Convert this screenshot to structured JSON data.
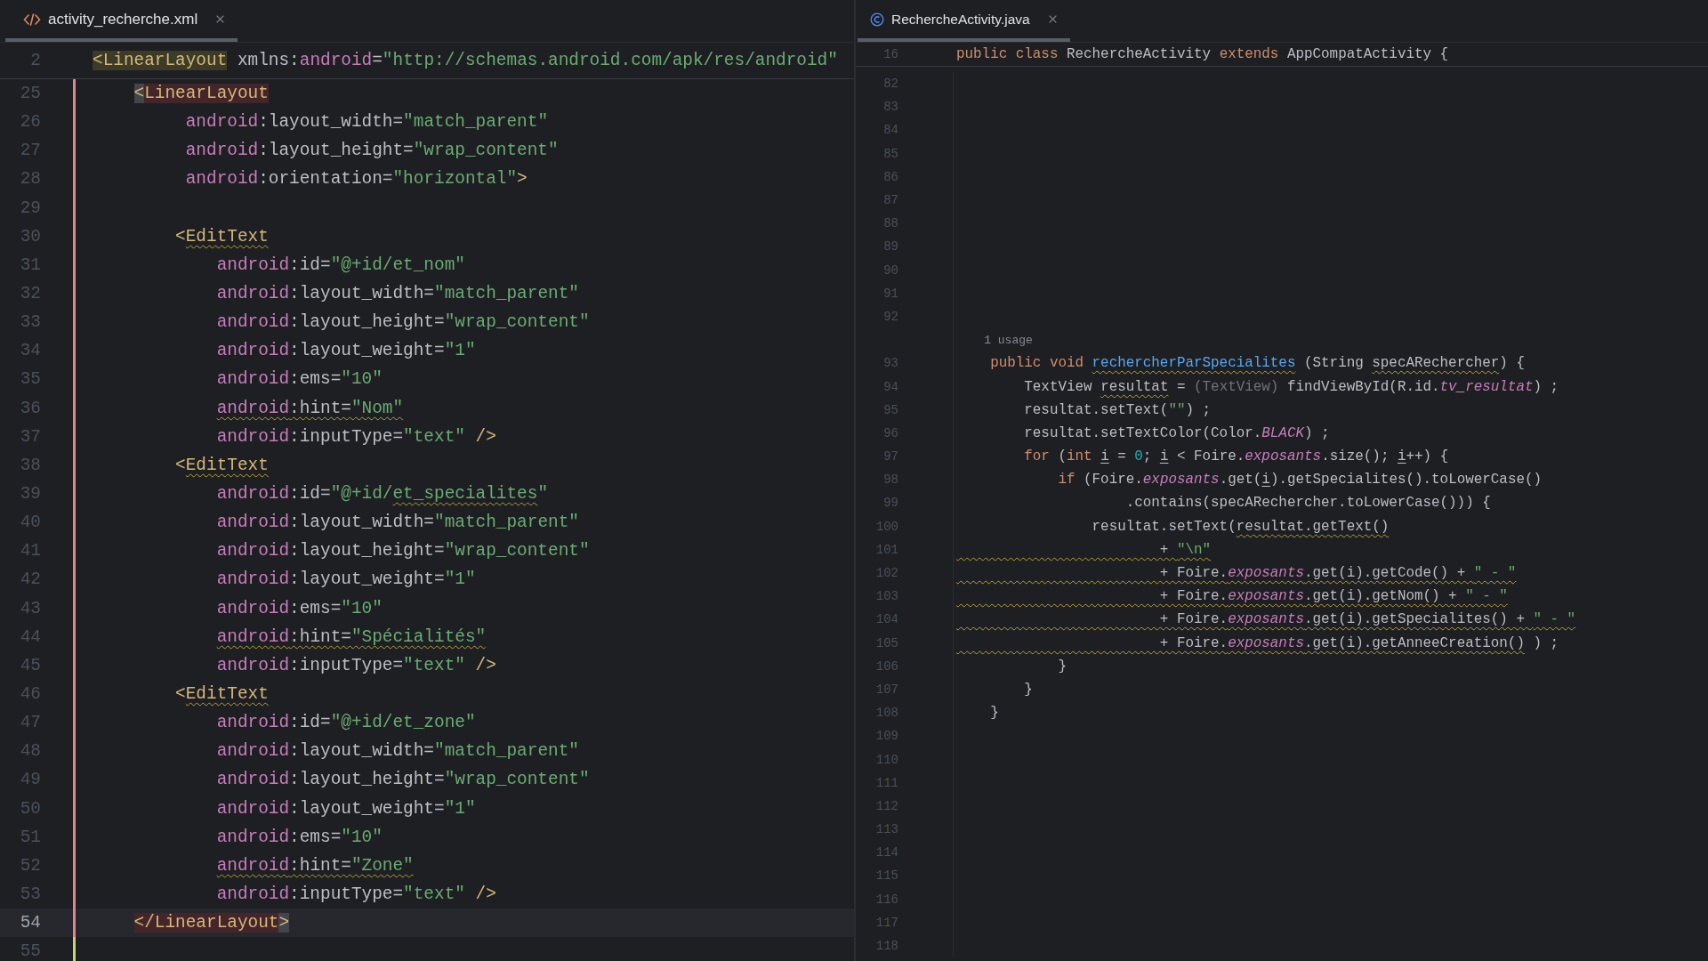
{
  "panes": [
    {
      "tab": {
        "label": "activity_recherche.xml",
        "selected": true
      },
      "sticky": {
        "n": "2",
        "tokens": [
          {
            "t": "<LinearLayout",
            "kind": "tag-match"
          },
          {
            "t": " xmlns:",
            "kind": "plain"
          },
          {
            "t": "android",
            "kind": "attr"
          },
          {
            "t": "=",
            "kind": "plain"
          },
          {
            "t": "\"http://schemas.android.com/apk/res/android\"",
            "kind": "str"
          }
        ]
      },
      "lines": [
        {
          "n": "25",
          "current": false,
          "kind": "modified",
          "tokens": [
            {
              "t": "    <",
              "kind": "tag-caret"
            },
            {
              "t": "LinearLayout",
              "kind": "tag-mismatch"
            }
          ]
        },
        {
          "n": "26",
          "current": false,
          "kind": "modified",
          "tokens": [
            {
              "t": "         android",
              "kind": "attr"
            },
            {
              "t": ":layout_width=",
              "kind": "plain"
            },
            {
              "t": "\"match_parent\"",
              "kind": "str"
            }
          ]
        },
        {
          "n": "27",
          "current": false,
          "kind": "modified",
          "tokens": [
            {
              "t": "         android",
              "kind": "attr"
            },
            {
              "t": ":layout_height=",
              "kind": "plain"
            },
            {
              "t": "\"wrap_content\"",
              "kind": "str"
            }
          ]
        },
        {
          "n": "28",
          "current": false,
          "kind": "modified",
          "tokens": [
            {
              "t": "         android",
              "kind": "attr"
            },
            {
              "t": ":orientation=",
              "kind": "plain"
            },
            {
              "t": "\"horizontal\"",
              "kind": "str"
            },
            {
              "t": ">",
              "kind": "tag"
            }
          ]
        },
        {
          "n": "29",
          "current": false,
          "kind": "modified"
        },
        {
          "n": "30",
          "current": false,
          "kind": "modified",
          "tokens": [
            {
              "t": "        <",
              "kind": "tag"
            },
            {
              "t": "EditText",
              "kind": "tag-wavy"
            }
          ]
        },
        {
          "n": "31",
          "current": false,
          "kind": "modified",
          "tokens": [
            {
              "t": "            android",
              "kind": "attr"
            },
            {
              "t": ":id=",
              "kind": "plain"
            },
            {
              "t": "\"@+id/et_nom\"",
              "kind": "str"
            }
          ]
        },
        {
          "n": "32",
          "current": false,
          "kind": "modified",
          "tokens": [
            {
              "t": "            android",
              "kind": "attr"
            },
            {
              "t": ":layout_width=",
              "kind": "plain"
            },
            {
              "t": "\"match_parent\"",
              "kind": "str"
            }
          ]
        },
        {
          "n": "33",
          "current": false,
          "kind": "modified",
          "tokens": [
            {
              "t": "            android",
              "kind": "attr"
            },
            {
              "t": ":layout_height=",
              "kind": "plain"
            },
            {
              "t": "\"wrap_content\"",
              "kind": "str"
            }
          ]
        },
        {
          "n": "34",
          "current": false,
          "kind": "modified",
          "tokens": [
            {
              "t": "            android",
              "kind": "attr"
            },
            {
              "t": ":layout_weight=",
              "kind": "plain"
            },
            {
              "t": "\"1\"",
              "kind": "str"
            }
          ]
        },
        {
          "n": "35",
          "current": false,
          "kind": "modified",
          "tokens": [
            {
              "t": "            android",
              "kind": "attr"
            },
            {
              "t": ":ems=",
              "kind": "plain"
            },
            {
              "t": "\"10\"",
              "kind": "str"
            }
          ]
        },
        {
          "n": "36",
          "current": false,
          "kind": "modified",
          "tokens": [
            {
              "t": "            android",
              "kind": "attr-wavy"
            },
            {
              "t": ":hint=",
              "kind": "plain-wavy"
            },
            {
              "t": "\"Nom\"",
              "kind": "str-wavy"
            }
          ]
        },
        {
          "n": "37",
          "current": false,
          "kind": "modified",
          "tokens": [
            {
              "t": "            android",
              "kind": "attr"
            },
            {
              "t": ":inputType=",
              "kind": "plain"
            },
            {
              "t": "\"text\"",
              "kind": "str"
            },
            {
              "t": " />",
              "kind": "tag"
            }
          ]
        },
        {
          "n": "38",
          "current": false,
          "kind": "modified",
          "tokens": [
            {
              "t": "        <",
              "kind": "tag"
            },
            {
              "t": "EditText",
              "kind": "tag-wavy"
            }
          ]
        },
        {
          "n": "39",
          "current": false,
          "kind": "modified",
          "tokens": [
            {
              "t": "            android",
              "kind": "attr"
            },
            {
              "t": ":id=",
              "kind": "plain"
            },
            {
              "t": "\"@+id/",
              "kind": "str"
            },
            {
              "t": "et_specialites",
              "kind": "str-wavy"
            },
            {
              "t": "\"",
              "kind": "str"
            }
          ]
        },
        {
          "n": "40",
          "current": false,
          "kind": "modified",
          "tokens": [
            {
              "t": "            android",
              "kind": "attr"
            },
            {
              "t": ":layout_width=",
              "kind": "plain"
            },
            {
              "t": "\"match_parent\"",
              "kind": "str"
            }
          ]
        },
        {
          "n": "41",
          "current": false,
          "kind": "modified",
          "tokens": [
            {
              "t": "            android",
              "kind": "attr"
            },
            {
              "t": ":layout_height=",
              "kind": "plain"
            },
            {
              "t": "\"wrap_content\"",
              "kind": "str"
            }
          ]
        },
        {
          "n": "42",
          "current": false,
          "kind": "modified",
          "tokens": [
            {
              "t": "            android",
              "kind": "attr"
            },
            {
              "t": ":layout_weight=",
              "kind": "plain"
            },
            {
              "t": "\"1\"",
              "kind": "str"
            }
          ]
        },
        {
          "n": "43",
          "current": false,
          "kind": "modified",
          "tokens": [
            {
              "t": "            android",
              "kind": "attr"
            },
            {
              "t": ":ems=",
              "kind": "plain"
            },
            {
              "t": "\"10\"",
              "kind": "str"
            }
          ]
        },
        {
          "n": "44",
          "current": false,
          "kind": "modified",
          "tokens": [
            {
              "t": "            android",
              "kind": "attr-wavy"
            },
            {
              "t": ":hint=",
              "kind": "plain-wavy"
            },
            {
              "t": "\"Spécialités\"",
              "kind": "str-wavy"
            }
          ]
        },
        {
          "n": "45",
          "current": false,
          "kind": "modified",
          "tokens": [
            {
              "t": "            android",
              "kind": "attr"
            },
            {
              "t": ":inputType=",
              "kind": "plain"
            },
            {
              "t": "\"text\"",
              "kind": "str"
            },
            {
              "t": " />",
              "kind": "tag"
            }
          ]
        },
        {
          "n": "46",
          "current": false,
          "kind": "modified",
          "tokens": [
            {
              "t": "        <",
              "kind": "tag"
            },
            {
              "t": "EditText",
              "kind": "tag-wavy"
            }
          ]
        },
        {
          "n": "47",
          "current": false,
          "kind": "modified",
          "tokens": [
            {
              "t": "            android",
              "kind": "attr"
            },
            {
              "t": ":id=",
              "kind": "plain"
            },
            {
              "t": "\"@+id/et_zone\"",
              "kind": "str"
            }
          ]
        },
        {
          "n": "48",
          "current": false,
          "kind": "modified",
          "tokens": [
            {
              "t": "            android",
              "kind": "attr"
            },
            {
              "t": ":layout_width=",
              "kind": "plain"
            },
            {
              "t": "\"match_parent\"",
              "kind": "str"
            }
          ]
        },
        {
          "n": "49",
          "current": false,
          "kind": "modified",
          "tokens": [
            {
              "t": "            android",
              "kind": "attr"
            },
            {
              "t": ":layout_height=",
              "kind": "plain"
            },
            {
              "t": "\"wrap_content\"",
              "kind": "str"
            }
          ]
        },
        {
          "n": "50",
          "current": false,
          "kind": "modified",
          "tokens": [
            {
              "t": "            android",
              "kind": "attr"
            },
            {
              "t": ":layout_weight=",
              "kind": "plain"
            },
            {
              "t": "\"1\"",
              "kind": "str"
            }
          ]
        },
        {
          "n": "51",
          "current": false,
          "kind": "modified",
          "tokens": [
            {
              "t": "            android",
              "kind": "attr"
            },
            {
              "t": ":ems=",
              "kind": "plain"
            },
            {
              "t": "\"10\"",
              "kind": "str"
            }
          ]
        },
        {
          "n": "52",
          "current": false,
          "kind": "modified",
          "tokens": [
            {
              "t": "            android",
              "kind": "attr-wavy"
            },
            {
              "t": ":hint=",
              "kind": "plain-wavy"
            },
            {
              "t": "\"Zone\"",
              "kind": "str-wavy"
            }
          ]
        },
        {
          "n": "53",
          "current": false,
          "kind": "modified",
          "tokens": [
            {
              "t": "            android",
              "kind": "attr"
            },
            {
              "t": ":inputType=",
              "kind": "plain"
            },
            {
              "t": "\"text\"",
              "kind": "str"
            },
            {
              "t": " />",
              "kind": "tag"
            }
          ]
        },
        {
          "n": "54",
          "current": true,
          "kind": "modified",
          "tokens": [
            {
              "t": "    </LinearLayout",
              "kind": "tag-mismatch"
            },
            {
              "t": ">",
              "kind": "tag-caret"
            }
          ]
        },
        {
          "n": "55",
          "current": false,
          "kind": "added"
        }
      ]
    },
    {
      "tab": {
        "label": "RechercheActivity.java",
        "selected": true
      },
      "sticky": {
        "n": "16",
        "tokens": [
          {
            "t": "public",
            "kind": "kw"
          },
          {
            "t": " class",
            "kind": "kw"
          },
          {
            "t": " RechercheActivity ",
            "kind": "plain"
          },
          {
            "t": "extends",
            "kind": "kw"
          },
          {
            "t": " AppCompatActivity {",
            "kind": "plain"
          }
        ]
      },
      "lines": [
        {
          "n": "82"
        },
        {
          "n": "83"
        },
        {
          "n": "84"
        },
        {
          "n": "85"
        },
        {
          "n": "86"
        },
        {
          "n": "87"
        },
        {
          "n": "88"
        },
        {
          "n": "89"
        },
        {
          "n": "90"
        },
        {
          "n": "91"
        },
        {
          "n": "92"
        },
        {
          "kind": "hint",
          "tokens": [
            {
              "t": "    1 usage",
              "kind": "muted"
            }
          ]
        },
        {
          "n": "93",
          "tokens": [
            {
              "t": "    public void ",
              "kind": "kw"
            },
            {
              "t": "rechercherParSpecialites",
              "kind": "decl-wavy"
            },
            {
              "t": " (String ",
              "kind": "plain"
            },
            {
              "t": "specARechercher",
              "kind": "plain-wavy"
            },
            {
              "t": ") {",
              "kind": "plain"
            }
          ]
        },
        {
          "n": "94",
          "tokens": [
            {
              "t": "        TextView ",
              "kind": "plain"
            },
            {
              "t": "resultat",
              "kind": "plain-wavy"
            },
            {
              "t": " = ",
              "kind": "plain"
            },
            {
              "t": "(TextView)",
              "kind": "muted"
            },
            {
              "t": " findViewById(R.id.",
              "kind": "plain"
            },
            {
              "t": "tv_resultat",
              "kind": "field"
            },
            {
              "t": ") ;",
              "kind": "plain"
            }
          ]
        },
        {
          "n": "95",
          "tokens": [
            {
              "t": "        resultat.setText(",
              "kind": "plain"
            },
            {
              "t": "\"\"",
              "kind": "str"
            },
            {
              "t": ") ;",
              "kind": "plain"
            }
          ]
        },
        {
          "n": "96",
          "tokens": [
            {
              "t": "        resultat.setTextColor(Color.",
              "kind": "plain"
            },
            {
              "t": "BLACK",
              "kind": "field"
            },
            {
              "t": ") ;",
              "kind": "plain"
            }
          ]
        },
        {
          "n": "97",
          "tokens": [
            {
              "t": "        for",
              "kind": "kw"
            },
            {
              "t": " (",
              "kind": "plain"
            },
            {
              "t": "int ",
              "kind": "kw"
            },
            {
              "t": "i",
              "kind": "plain-line"
            },
            {
              "t": " = ",
              "kind": "plain"
            },
            {
              "t": "0",
              "kind": "num"
            },
            {
              "t": "; ",
              "kind": "plain"
            },
            {
              "t": "i",
              "kind": "plain-line"
            },
            {
              "t": " < Foire.",
              "kind": "plain"
            },
            {
              "t": "exposants",
              "kind": "field"
            },
            {
              "t": ".size(); ",
              "kind": "plain"
            },
            {
              "t": "i",
              "kind": "plain-line"
            },
            {
              "t": "++) {",
              "kind": "plain"
            }
          ]
        },
        {
          "n": "98",
          "tokens": [
            {
              "t": "            if",
              "kind": "kw"
            },
            {
              "t": " (Foire.",
              "kind": "plain"
            },
            {
              "t": "exposants",
              "kind": "field"
            },
            {
              "t": ".get(",
              "kind": "plain"
            },
            {
              "t": "i",
              "kind": "plain-line"
            },
            {
              "t": ").getSpecialites().toLowerCase()",
              "kind": "plain"
            }
          ]
        },
        {
          "n": "99",
          "tokens": [
            {
              "t": "                    .contains(specARechercher.toLowerCase())) {",
              "kind": "plain"
            }
          ]
        },
        {
          "n": "100",
          "tokens": [
            {
              "t": "                resultat.setText(",
              "kind": "plain"
            },
            {
              "t": "resultat.getText()",
              "kind": "plain-wavy"
            }
          ]
        },
        {
          "n": "101",
          "tokens": [
            {
              "t": "                        + ",
              "kind": "plain-wavyall"
            },
            {
              "t": "\"\\n\"",
              "kind": "str-wavy"
            }
          ]
        },
        {
          "n": "102",
          "tokens": [
            {
              "t": "                        + Foire.",
              "kind": "plain-wavyall"
            },
            {
              "t": "exposants",
              "kind": "field-wavy"
            },
            {
              "t": ".get(i).getCode() + ",
              "kind": "plain-wavy"
            },
            {
              "t": "\" - \"",
              "kind": "str-wavy"
            }
          ]
        },
        {
          "n": "103",
          "tokens": [
            {
              "t": "                        + Foire.",
              "kind": "plain-wavyall"
            },
            {
              "t": "exposants",
              "kind": "field-wavy"
            },
            {
              "t": ".get(i).getNom() + ",
              "kind": "plain-wavy"
            },
            {
              "t": "\" - \"",
              "kind": "str-wavy"
            }
          ]
        },
        {
          "n": "104",
          "tokens": [
            {
              "t": "                        + Foire.",
              "kind": "plain-wavyall"
            },
            {
              "t": "exposants",
              "kind": "field-wavy"
            },
            {
              "t": ".get(i).getSpecialites() + ",
              "kind": "plain-wavy"
            },
            {
              "t": "\" - \"",
              "kind": "str-wavy"
            }
          ]
        },
        {
          "n": "105",
          "tokens": [
            {
              "t": "                        + Foire.",
              "kind": "plain-wavyall"
            },
            {
              "t": "exposants",
              "kind": "field-wavy"
            },
            {
              "t": ".get(i).getAnneeCreation()",
              "kind": "plain-wavy"
            },
            {
              "t": " ) ;",
              "kind": "plain"
            }
          ]
        },
        {
          "n": "106",
          "tokens": [
            {
              "t": "            }",
              "kind": "plain"
            }
          ]
        },
        {
          "n": "107",
          "tokens": [
            {
              "t": "        }",
              "kind": "plain"
            }
          ]
        },
        {
          "n": "108",
          "tokens": [
            {
              "t": "    }",
              "kind": "plain"
            }
          ]
        },
        {
          "n": "109"
        },
        {
          "n": "110"
        },
        {
          "n": "111"
        },
        {
          "n": "112"
        },
        {
          "n": "113"
        },
        {
          "n": "114"
        },
        {
          "n": "115"
        },
        {
          "n": "116"
        },
        {
          "n": "117"
        },
        {
          "n": "118"
        }
      ]
    }
  ]
}
